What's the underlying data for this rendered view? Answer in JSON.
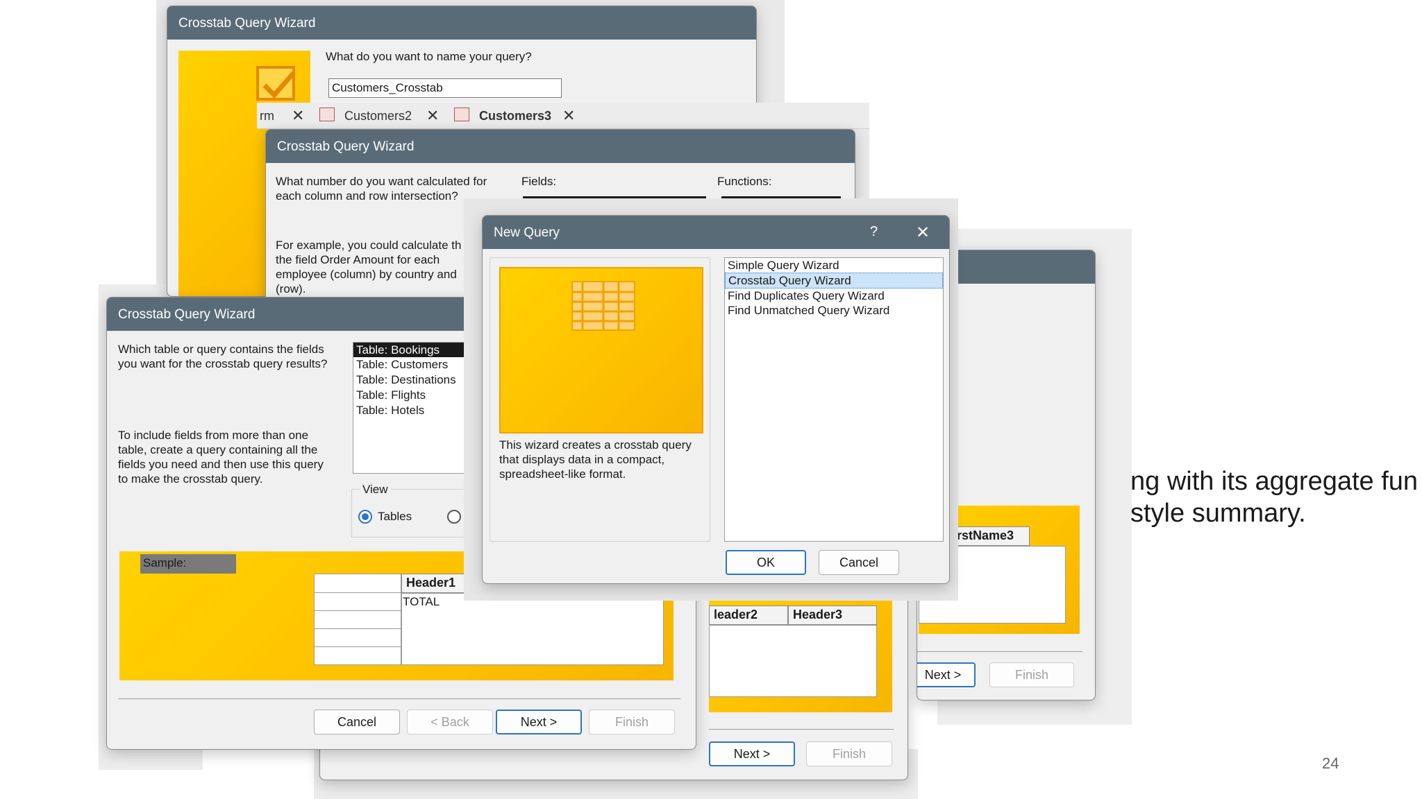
{
  "dialog_name": {
    "title": "Crosstab Query Wizard",
    "question": "What do you want to name your query?",
    "query_name_value": "Customers_Crosstab"
  },
  "tabs": [
    {
      "label": "rm"
    },
    {
      "label": "Customers2"
    },
    {
      "label": "Customers3"
    }
  ],
  "dialog_fields": {
    "title": "Crosstab Query Wizard",
    "question": "What number do you want calculated for each column and row intersection?",
    "fields_label": "Fields:",
    "functions_label": "Functions:",
    "example": "For example, you could calculate th of the field Order Amount for each employee (column) by country and (row)."
  },
  "dialog_table": {
    "title": "Crosstab Query Wizard",
    "question": "Which table or query contains the fields you want for the crosstab query results?",
    "hint": "To include fields from more than one table, create a query containing all the fields you need and then use this query to make the crosstab query.",
    "tables": [
      "Table: Bookings",
      "Table: Customers",
      "Table: Destinations",
      "Table: Flights",
      "Table: Hotels"
    ],
    "view_label": "View",
    "view_tables": "Tables",
    "sample_label": "Sample:",
    "header1": "Header1",
    "total": "TOTAL",
    "buttons": {
      "cancel": "Cancel",
      "back": "< Back",
      "next": "Next >",
      "finish": "Finish"
    }
  },
  "dialog_back_lower": {
    "header2": "leader2",
    "header3": "Header3",
    "next": "Next >",
    "finish": "Finish"
  },
  "dialog_right": {
    "firstname": "FirstName3",
    "col_prefix": "2",
    "next": "Next >",
    "finish": "Finish"
  },
  "new_query": {
    "title": "New Query",
    "help": "?",
    "description": "This wizard creates a crosstab query that displays data in a compact, spreadsheet-like format.",
    "options": [
      "Simple Query Wizard",
      "Crosstab Query Wizard",
      "Find Duplicates Query Wizard",
      "Find Unmatched Query Wizard"
    ],
    "ok": "OK",
    "cancel": "Cancel"
  },
  "slide": {
    "text_line1": "ng with its aggregate fun",
    "text_line2": "style summary.",
    "page_number": "24"
  },
  "colors": {
    "title_bar": "#5a6b78",
    "accent": "#2b74c7",
    "wizard_yellow": "#ffc400"
  }
}
